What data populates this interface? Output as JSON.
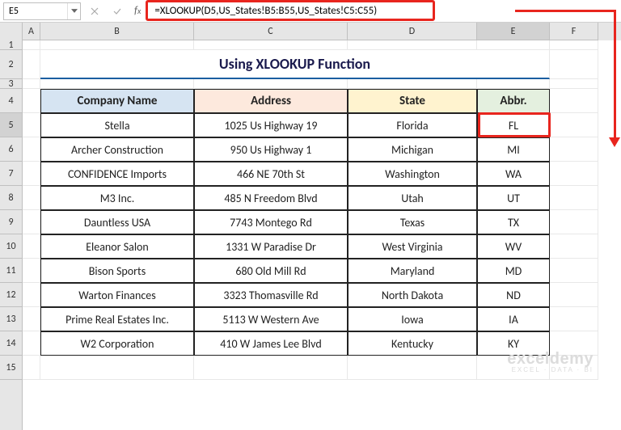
{
  "namebox": {
    "value": "E5"
  },
  "formula": {
    "value": "=XLOOKUP(D5,US_States!B5:B55,US_States!C5:C55)"
  },
  "columns": [
    "A",
    "B",
    "C",
    "D",
    "E",
    "F"
  ],
  "rows_visible": [
    "1",
    "2",
    "3",
    "4",
    "5",
    "6",
    "7",
    "8",
    "9",
    "10",
    "11",
    "12",
    "13",
    "14",
    "15"
  ],
  "title": "Using XLOOKUP Function",
  "headers": {
    "B": "Company Name",
    "C": "Address",
    "D": "State",
    "E": "Abbr."
  },
  "chart_data": {
    "type": "table",
    "columns": [
      "Company Name",
      "Address",
      "State",
      "Abbr."
    ],
    "rows": [
      [
        "Stella",
        "1025 Us Highway 19",
        "Florida",
        "FL"
      ],
      [
        "Archer Construction",
        "950 Us Highway 1",
        "Michigan",
        "MI"
      ],
      [
        "CONFIDENCE Imports",
        "466 NE 70th St",
        "Washington",
        "WA"
      ],
      [
        "M3 Inc.",
        "485 N Freedom Blvd",
        "Utah",
        "UT"
      ],
      [
        "Dauntless USA",
        "7743 Montego Rd",
        "Texas",
        "TX"
      ],
      [
        "Eleanor Salon",
        "1331 W Paradise Dr",
        "West Virginia",
        "WV"
      ],
      [
        "Bison Sports",
        "680 Old Mill Rd",
        "Maryland",
        "MD"
      ],
      [
        "Warton Finances",
        "3323 Thomasville Rd",
        "North Dakota",
        "ND"
      ],
      [
        "Prime Real Estates Inc.",
        "5113 W Western Ave",
        "Iowa",
        "IA"
      ],
      [
        "W2 Corporation",
        "410 W James Lee Blvd",
        "Kentucky",
        "KY"
      ]
    ]
  },
  "watermark": {
    "big": "exceldemy",
    "small": "EXCEL · DATA · BI"
  },
  "selected_cell": "E5"
}
